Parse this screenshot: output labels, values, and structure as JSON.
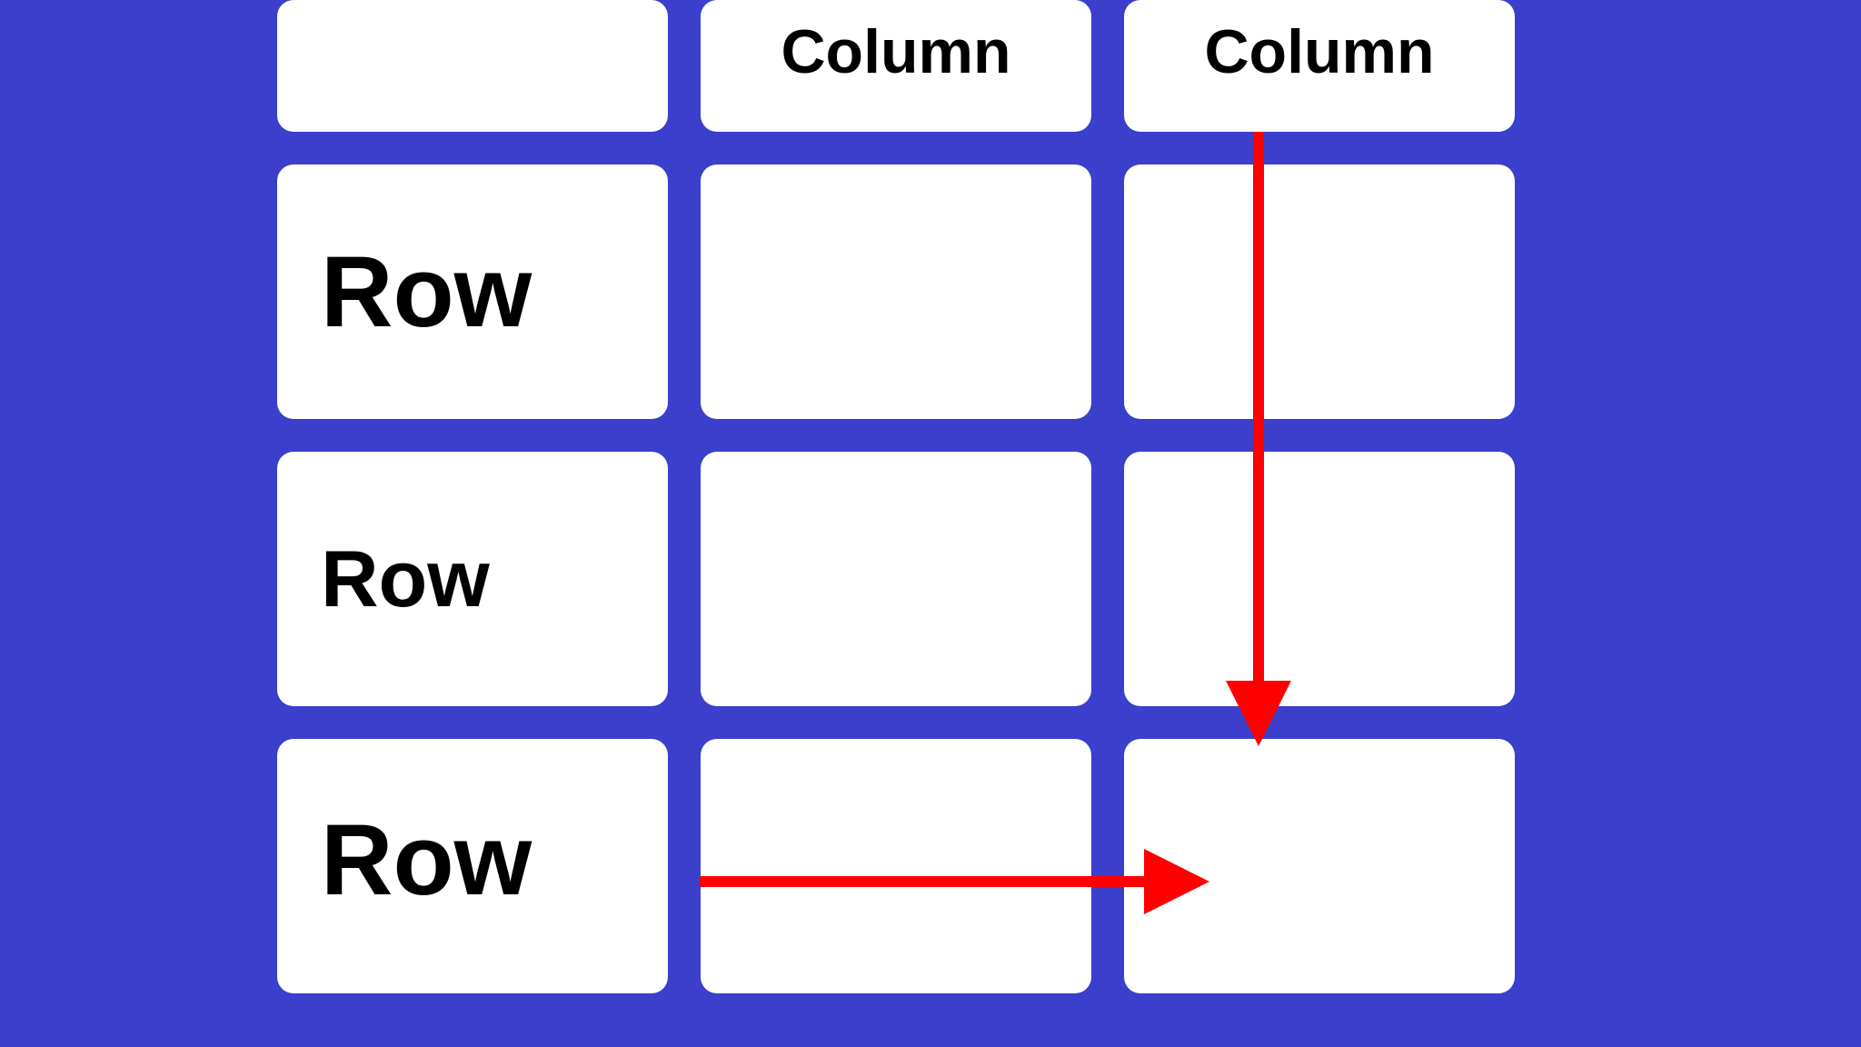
{
  "headers": {
    "col1": "",
    "col2": "Column",
    "col3": "Column"
  },
  "rows": {
    "r1": "Row",
    "r2": "Row",
    "r3": "Row"
  },
  "colors": {
    "background": "#3b3fcc",
    "cell": "#ffffff",
    "arrow": "#ff0000",
    "text": "#000000"
  }
}
